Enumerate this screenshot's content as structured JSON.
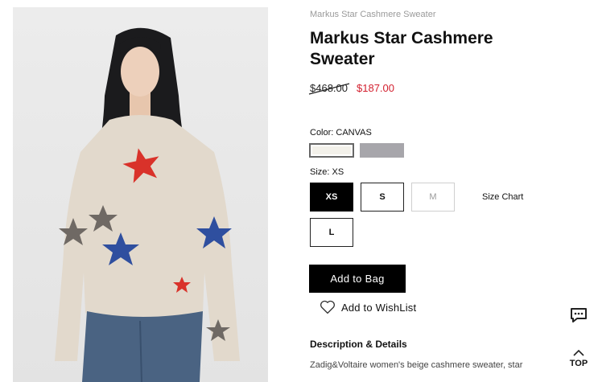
{
  "breadcrumb": "Markus Star Cashmere Sweater",
  "product": {
    "title": "Markus Star Cashmere Sweater",
    "price_original": "$468.00",
    "price_sale": "$187.00"
  },
  "color": {
    "label": "Color: CANVAS",
    "swatches": [
      {
        "name": "CANVAS",
        "hex": "#f3f1ea",
        "selected": true
      },
      {
        "name": "grey",
        "hex": "#a7a6ab",
        "selected": false
      }
    ]
  },
  "size": {
    "label": "Size: XS",
    "options": [
      "XS",
      "S",
      "M",
      "L"
    ],
    "selected": "XS",
    "unavailable": [
      "M"
    ],
    "chart_label": "Size Chart"
  },
  "actions": {
    "add_to_bag": "Add to Bag",
    "wishlist": "Add to WishList"
  },
  "description": {
    "heading": "Description & Details",
    "text": "Zadig&Voltaire women's beige cashmere sweater, star"
  },
  "widgets": {
    "top_label": "TOP"
  },
  "colors": {
    "sale_red": "#d3202f",
    "button_black": "#000000"
  }
}
